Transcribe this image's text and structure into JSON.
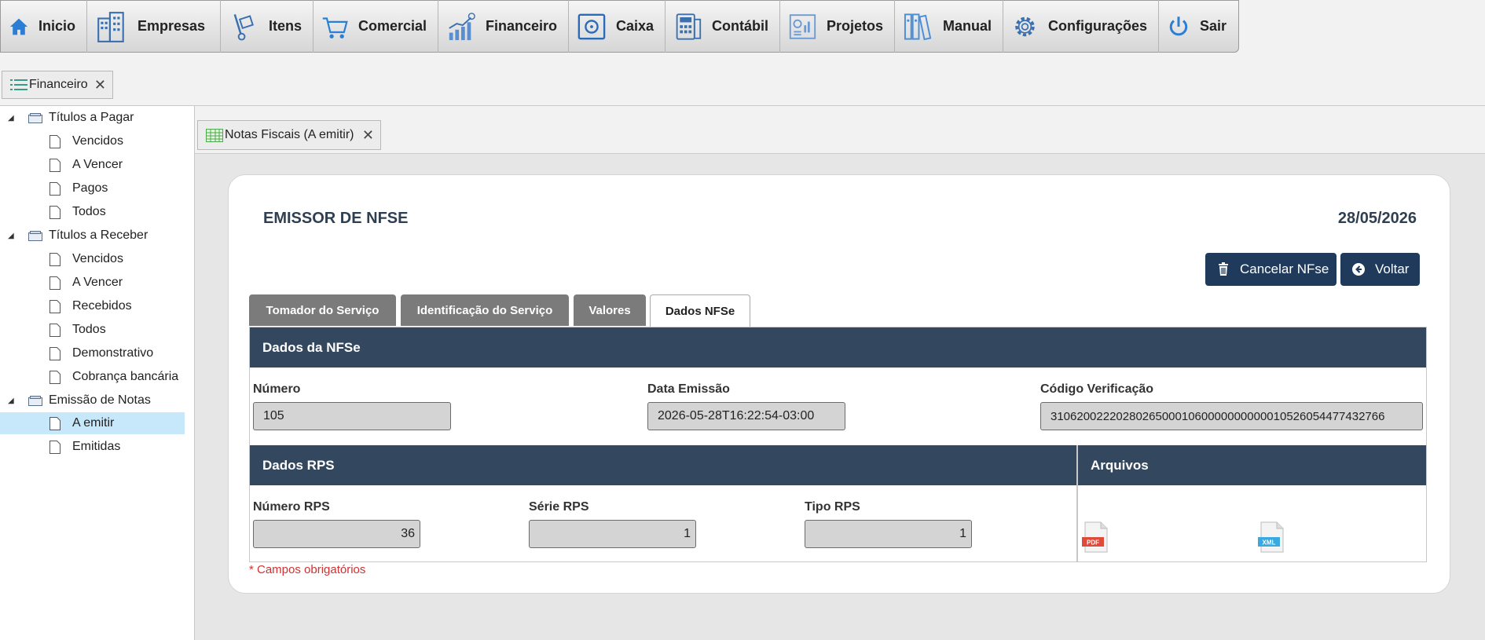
{
  "menu": [
    {
      "label": "Inicio",
      "icon": "home-icon"
    },
    {
      "label": "Empresas",
      "icon": "buildings-icon"
    },
    {
      "label": "Itens",
      "icon": "hand-truck-icon"
    },
    {
      "label": "Comercial",
      "icon": "shopping-cart-icon"
    },
    {
      "label": "Financeiro",
      "icon": "growth-chart-icon"
    },
    {
      "label": "Caixa",
      "icon": "safe-icon"
    },
    {
      "label": "Contábil",
      "icon": "calculator-icon"
    },
    {
      "label": "Projetos",
      "icon": "project-board-icon"
    },
    {
      "label": "Manual",
      "icon": "binders-icon"
    },
    {
      "label": "Configurações",
      "icon": "gear-icon"
    },
    {
      "label": "Sair",
      "icon": "power-icon"
    }
  ],
  "module_tab": {
    "label": "Financeiro",
    "close": "✕"
  },
  "tree": {
    "titulos_pagar": {
      "label": "Títulos a Pagar",
      "items": [
        "Vencidos",
        "A Vencer",
        "Pagos",
        "Todos"
      ]
    },
    "titulos_receber": {
      "label": "Títulos a Receber",
      "items": [
        "Vencidos",
        "A Vencer",
        "Recebidos",
        "Todos",
        "Demonstrativo",
        "Cobrança bancária"
      ]
    },
    "emissao_notas": {
      "label": "Emissão de Notas",
      "items": [
        "A emitir",
        "Emitidas"
      ]
    }
  },
  "subtab": {
    "label": "Notas Fiscais (A emitir)",
    "close": "✕"
  },
  "card": {
    "title": "EMISSOR DE NFSE",
    "date": "28/05/2026",
    "cancel_label": "Cancelar NFse",
    "back_label": "Voltar"
  },
  "form_tabs": [
    "Tomador do Serviço",
    "Identificação do Serviço",
    "Valores",
    "Dados NFSe"
  ],
  "nfse": {
    "heading": "Dados da NFSe",
    "numero_label": "Número",
    "numero": "105",
    "data_label": "Data Emissão",
    "data": "2026-05-28T16:22:54-03:00",
    "codigo_label": "Código Verificação",
    "codigo": "310620022202802650001060000000000010526054477432766"
  },
  "rps": {
    "heading": "Dados RPS",
    "numero_label": "Número RPS",
    "numero": "36",
    "serie_label": "Série RPS",
    "serie": "1",
    "tipo_label": "Tipo RPS",
    "tipo": "1"
  },
  "arquivos": {
    "heading": "Arquivos",
    "pdf": "PDF",
    "xml": "XML"
  },
  "required_note": "* Campos obrigatórios",
  "colors": {
    "accent": "#1f3a5a",
    "section": "#33475e",
    "tab_inactive": "#7b7b7b",
    "selected_row": "#c7e7fb",
    "required": "#d43030"
  }
}
